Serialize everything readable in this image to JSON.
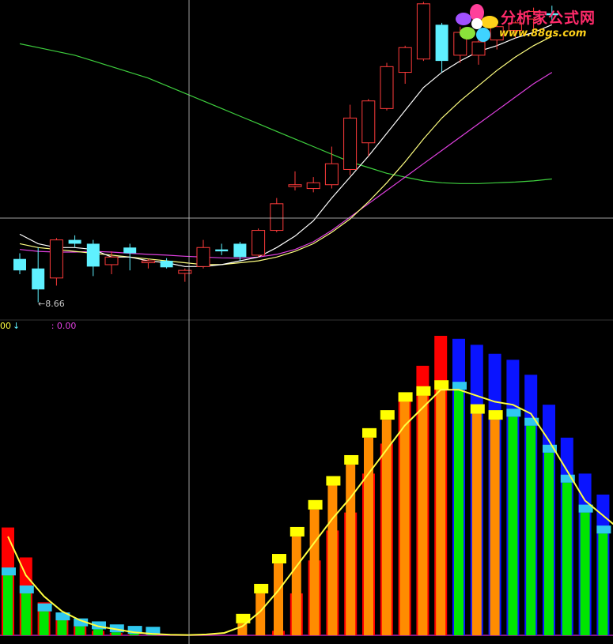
{
  "logo": {
    "title": "分析家公式网",
    "url": "www.88gs.com",
    "icon": "flower-logo-icon"
  },
  "upper_panel": {
    "low_marker": "8.66",
    "low_arrow": "←"
  },
  "lower_panel": {
    "indicator_left": "00",
    "indicator_arrow": "↓",
    "indicator_right": ": 0.00"
  },
  "colors": {
    "background": "#000000",
    "candle_up": "#ff3b3b",
    "candle_down": "#5ff0ff",
    "ma_white": "#ffffff",
    "ma_yellow": "#ffff80",
    "ma_magenta": "#e040e0",
    "ma_green": "#3ecf3e",
    "crosshair": "#c8c8c8",
    "bar_red": "#ff0000",
    "bar_blue": "#0a14ff",
    "bar_orange": "#ff8c00",
    "bar_green": "#00e600",
    "cap_yellow": "#ffff00",
    "cap_cyan": "#30c8f0",
    "signal_line": "#ffff40"
  },
  "chart_data": [
    {
      "type": "candlestick",
      "title": "",
      "candles": [
        {
          "o": 9.8,
          "h": 9.95,
          "l": 9.4,
          "c": 9.5
        },
        {
          "o": 9.55,
          "h": 10.1,
          "l": 8.66,
          "c": 9.0
        },
        {
          "o": 9.3,
          "h": 10.35,
          "l": 9.1,
          "c": 10.3
        },
        {
          "o": 10.3,
          "h": 10.42,
          "l": 10.1,
          "c": 10.2
        },
        {
          "o": 10.2,
          "h": 10.3,
          "l": 9.35,
          "c": 9.6
        },
        {
          "o": 9.65,
          "h": 10.0,
          "l": 9.4,
          "c": 9.85
        },
        {
          "o": 10.1,
          "h": 10.2,
          "l": 9.5,
          "c": 9.95
        },
        {
          "o": 9.7,
          "h": 9.8,
          "l": 9.55,
          "c": 9.75
        },
        {
          "o": 9.75,
          "h": 9.82,
          "l": 9.55,
          "c": 9.58
        },
        {
          "o": 9.42,
          "h": 9.55,
          "l": 9.2,
          "c": 9.5
        },
        {
          "o": 9.6,
          "h": 10.3,
          "l": 9.55,
          "c": 10.1
        },
        {
          "o": 10.05,
          "h": 10.2,
          "l": 9.9,
          "c": 10.0
        },
        {
          "o": 10.2,
          "h": 10.25,
          "l": 9.75,
          "c": 9.85
        },
        {
          "o": 9.9,
          "h": 10.6,
          "l": 9.85,
          "c": 10.55
        },
        {
          "o": 10.55,
          "h": 11.4,
          "l": 10.5,
          "c": 11.25
        },
        {
          "o": 11.7,
          "h": 12.1,
          "l": 11.6,
          "c": 11.75
        },
        {
          "o": 11.65,
          "h": 11.95,
          "l": 11.55,
          "c": 11.8
        },
        {
          "o": 11.75,
          "h": 12.75,
          "l": 11.65,
          "c": 12.3
        },
        {
          "o": 12.15,
          "h": 13.85,
          "l": 12.0,
          "c": 13.5
        },
        {
          "o": 12.85,
          "h": 14.0,
          "l": 12.5,
          "c": 13.95
        },
        {
          "o": 13.75,
          "h": 14.95,
          "l": 13.7,
          "c": 14.85
        },
        {
          "o": 14.7,
          "h": 15.4,
          "l": 14.4,
          "c": 15.35
        },
        {
          "o": 15.05,
          "h": 16.55,
          "l": 15.0,
          "c": 16.5
        },
        {
          "o": 15.95,
          "h": 16.0,
          "l": 14.7,
          "c": 15.0
        },
        {
          "o": 15.15,
          "h": 15.9,
          "l": 14.95,
          "c": 15.75
        },
        {
          "o": 15.15,
          "h": 15.8,
          "l": 14.9,
          "c": 15.5
        },
        {
          "o": 15.55,
          "h": 15.95,
          "l": 15.3,
          "c": 15.9
        },
        {
          "o": 15.8,
          "h": 16.05,
          "l": 15.6,
          "c": 16.0
        },
        {
          "o": 16.1,
          "h": 16.4,
          "l": 15.85,
          "c": 16.3
        },
        {
          "o": 16.25,
          "h": 16.45,
          "l": 16.0,
          "c": 16.2
        }
      ],
      "ma_white": [
        10.45,
        10.2,
        10.1,
        10.1,
        10.05,
        9.85,
        9.85,
        9.75,
        9.7,
        9.6,
        9.6,
        9.65,
        9.75,
        9.85,
        10.1,
        10.4,
        10.8,
        11.4,
        11.95,
        12.5,
        13.1,
        13.7,
        14.3,
        14.7,
        15.0,
        15.25,
        15.4,
        15.6,
        15.75,
        15.95
      ],
      "ma_yellow": [
        10.2,
        10.1,
        10.05,
        10.0,
        9.95,
        9.9,
        9.85,
        9.8,
        9.75,
        9.7,
        9.65,
        9.65,
        9.7,
        9.75,
        9.85,
        10.0,
        10.2,
        10.5,
        10.85,
        11.3,
        11.8,
        12.35,
        12.95,
        13.5,
        13.95,
        14.35,
        14.75,
        15.1,
        15.4,
        15.65
      ],
      "ma_magenta": [
        10.05,
        10.0,
        9.98,
        9.98,
        10.0,
        9.98,
        9.95,
        9.92,
        9.9,
        9.87,
        9.85,
        9.83,
        9.82,
        9.85,
        9.92,
        10.05,
        10.25,
        10.55,
        10.9,
        11.25,
        11.6,
        11.95,
        12.3,
        12.65,
        13.0,
        13.35,
        13.7,
        14.05,
        14.4,
        14.7
      ],
      "ma_green": [
        15.45,
        15.35,
        15.25,
        15.15,
        15.0,
        14.85,
        14.7,
        14.55,
        14.35,
        14.15,
        13.95,
        13.75,
        13.55,
        13.35,
        13.15,
        12.95,
        12.75,
        12.55,
        12.35,
        12.2,
        12.05,
        11.95,
        11.85,
        11.8,
        11.78,
        11.78,
        11.8,
        11.82,
        11.85,
        11.9
      ],
      "ylim": [
        8.3,
        16.6
      ],
      "annotations": [
        "8.66"
      ]
    },
    {
      "type": "bar",
      "title": "",
      "ylim": [
        0,
        100
      ],
      "red": [
        36,
        26,
        11,
        5,
        3,
        1.5,
        0.8,
        0.3,
        0.1,
        0,
        0,
        0,
        0,
        0,
        0.2,
        1.5,
        14,
        25,
        35,
        41,
        54,
        64,
        81,
        90,
        100,
        100,
        100,
        100,
        100,
        100,
        100,
        100,
        100,
        100,
        100
      ],
      "blue": [
        0,
        0,
        0,
        0,
        0,
        0,
        0,
        0,
        0,
        0,
        0,
        0,
        0,
        0,
        0,
        0,
        0,
        0,
        0,
        0,
        0,
        0,
        0,
        0,
        0,
        99,
        97,
        94,
        92,
        87,
        77,
        66,
        54,
        47,
        35
      ],
      "orange": [
        0,
        0,
        0,
        0,
        0,
        0,
        0,
        0,
        0,
        0,
        0,
        0,
        0,
        4,
        14,
        24,
        33,
        42,
        50,
        57,
        66,
        72,
        78,
        80,
        82,
        0,
        74,
        72,
        0,
        0,
        0,
        0,
        0,
        0,
        0
      ],
      "green": [
        20,
        14,
        8,
        5,
        3,
        2,
        1,
        0.5,
        0.2,
        0,
        0,
        0,
        0,
        0,
        0,
        0,
        0,
        0,
        0,
        0,
        0,
        0,
        0,
        0,
        0,
        82,
        0,
        0,
        73,
        70,
        61,
        51,
        41,
        34,
        29
      ],
      "signal": [
        33,
        20,
        13,
        8,
        5,
        3,
        2,
        1,
        0.5,
        0.2,
        0.1,
        0.3,
        0.8,
        3,
        8,
        15,
        23,
        31,
        39,
        46,
        54,
        62,
        70,
        76,
        82,
        82,
        80,
        78,
        77,
        74,
        65,
        55,
        45,
        40,
        35
      ]
    }
  ]
}
